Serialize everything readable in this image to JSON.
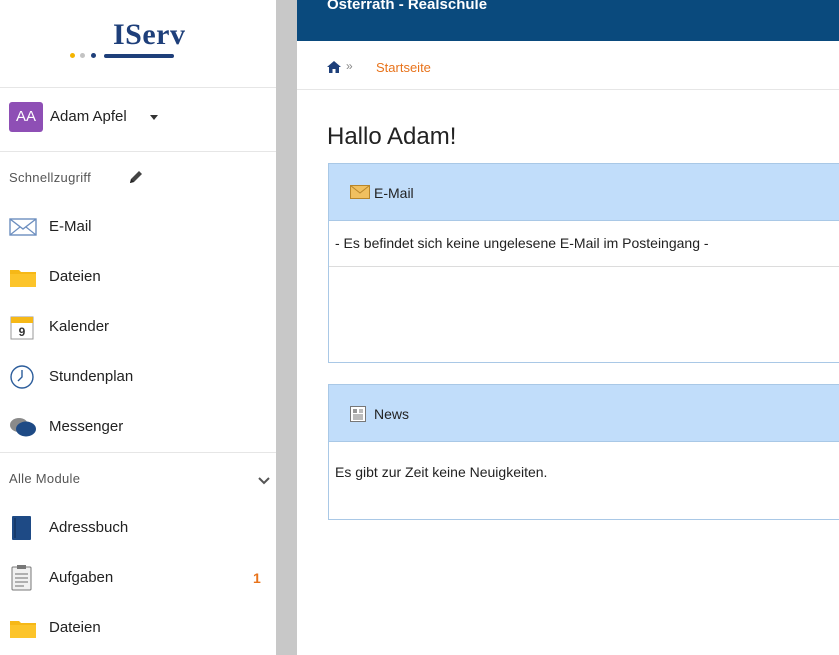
{
  "logo": {
    "text": "IServ",
    "dot_colors": [
      "#f4b400",
      "#c3c3c3",
      "#1e3f7a"
    ]
  },
  "user": {
    "initials": "AA",
    "name": "Adam Apfel",
    "avatar_color": "#8e4fb5"
  },
  "quick_access": {
    "label": "Schnellzugriff",
    "items": [
      {
        "label": "E-Mail",
        "icon": "envelope-icon"
      },
      {
        "label": "Dateien",
        "icon": "folder-icon"
      },
      {
        "label": "Kalender",
        "icon": "calendar-icon",
        "calendar_day": "9"
      },
      {
        "label": "Stundenplan",
        "icon": "clock-icon"
      },
      {
        "label": "Messenger",
        "icon": "chat-bubbles-icon"
      }
    ]
  },
  "all_modules": {
    "label": "Alle Module",
    "items": [
      {
        "label": "Adressbuch",
        "icon": "address-book-icon"
      },
      {
        "label": "Aufgaben",
        "icon": "clipboard-icon",
        "badge": "1"
      },
      {
        "label": "Dateien",
        "icon": "folder-icon"
      }
    ]
  },
  "header": {
    "school": "Osterrath - Realschule"
  },
  "breadcrumb": {
    "separator": "»",
    "current": "Startseite"
  },
  "greeting": "Hallo Adam!",
  "panels": [
    {
      "title": "E-Mail",
      "icon": "mail-envelope-icon",
      "message": "- Es befindet sich keine ungelesene E-Mail im Posteingang -"
    },
    {
      "title": "News",
      "icon": "newspaper-icon",
      "message": "Es gibt zur Zeit keine Neuigkeiten."
    }
  ],
  "colors": {
    "accent": "#e8731b",
    "topbar": "#0a4a7d",
    "panel_head": "#c1ddfa",
    "folder": "#f6b817"
  }
}
